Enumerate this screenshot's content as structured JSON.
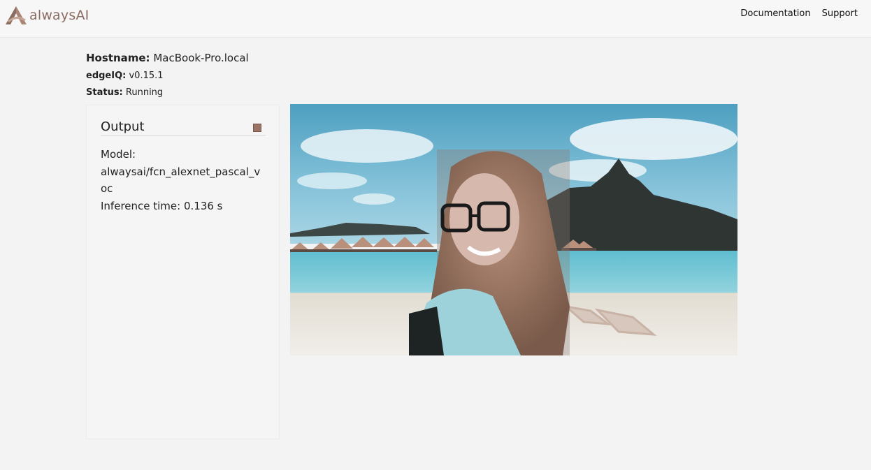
{
  "brand": {
    "name": "alwaysAI",
    "accent": "#8a6c60"
  },
  "nav": {
    "links": [
      "Documentation",
      "Support"
    ]
  },
  "info": {
    "hostname_label": "Hostname:",
    "hostname": "MacBook-Pro.local",
    "edgeiq_label": "edgeIQ:",
    "edgeiq_version": "v0.15.1",
    "status_label": "Status:",
    "status": "Running"
  },
  "output": {
    "title": "Output",
    "stop_icon": "stop-square-icon",
    "model_label": "Model:",
    "model": "alwaysai/fcn_alexnet_pascal_voc",
    "inference_line": "Inference time: 0.136 s"
  },
  "stream": {
    "description_icon": "video-frame"
  }
}
